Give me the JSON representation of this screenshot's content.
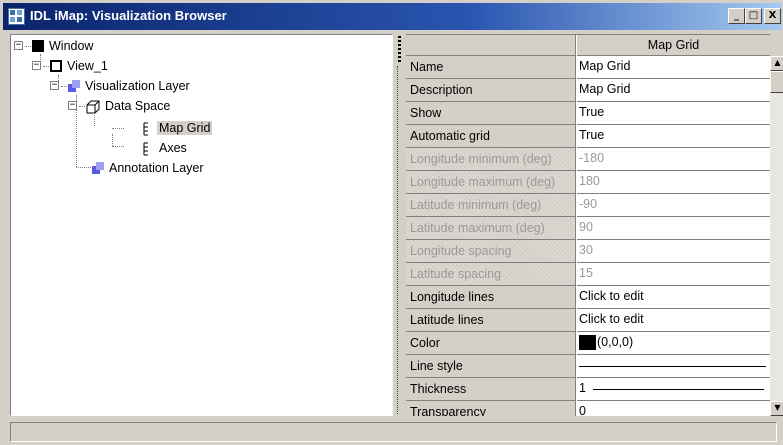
{
  "window": {
    "title": "IDL iMap: Visualization Browser",
    "controls": {
      "minimize": "_",
      "maximize": "□",
      "close": "X"
    }
  },
  "tree": {
    "items": [
      {
        "label": "Window",
        "icon": "window-icon",
        "expander": "−"
      },
      {
        "label": "View_1",
        "icon": "view-icon",
        "expander": "−"
      },
      {
        "label": "Visualization Layer",
        "icon": "layer-icon",
        "expander": "−"
      },
      {
        "label": "Data Space",
        "icon": "dataspace-icon",
        "expander": "−"
      },
      {
        "label": "Map Grid",
        "icon": "mapgrid-icon",
        "selected": true
      },
      {
        "label": "Axes",
        "icon": "axes-icon"
      },
      {
        "label": "Annotation Layer",
        "icon": "layer-icon"
      }
    ]
  },
  "properties": {
    "header": "Map Grid",
    "rows": [
      {
        "name": "Name",
        "value": "Map Grid",
        "enabled": true
      },
      {
        "name": "Description",
        "value": "Map Grid",
        "enabled": true
      },
      {
        "name": "Show",
        "value": "True",
        "enabled": true
      },
      {
        "name": "Automatic grid",
        "value": "True",
        "enabled": true
      },
      {
        "name": "Longitude minimum (deg)",
        "value": "-180",
        "enabled": false
      },
      {
        "name": "Longitude maximum (deg)",
        "value": "180",
        "enabled": false
      },
      {
        "name": "Latitude minimum (deg)",
        "value": "-90",
        "enabled": false
      },
      {
        "name": "Latitude maximum (deg)",
        "value": "90",
        "enabled": false
      },
      {
        "name": "Longitude spacing",
        "value": "30",
        "enabled": false
      },
      {
        "name": "Latitude spacing",
        "value": "15",
        "enabled": false
      },
      {
        "name": "Longitude lines",
        "value": "Click to edit",
        "enabled": true
      },
      {
        "name": "Latitude lines",
        "value": "Click to edit",
        "enabled": true
      },
      {
        "name": "Color",
        "value": "(0,0,0)",
        "enabled": true,
        "swatch": "#000000"
      },
      {
        "name": "Line style",
        "value": "",
        "enabled": true,
        "line": "solid"
      },
      {
        "name": "Thickness",
        "value": "1",
        "enabled": true,
        "line": "solid"
      },
      {
        "name": "Transparency",
        "value": "0",
        "enabled": true
      }
    ]
  },
  "scrollbar": {
    "up": "▲",
    "down": "▼"
  },
  "colors": {
    "titlebar_start": "#0a246a",
    "titlebar_end": "#a6caf0",
    "face": "#d4d0c8",
    "disabled_text": "#9a9a9a"
  }
}
